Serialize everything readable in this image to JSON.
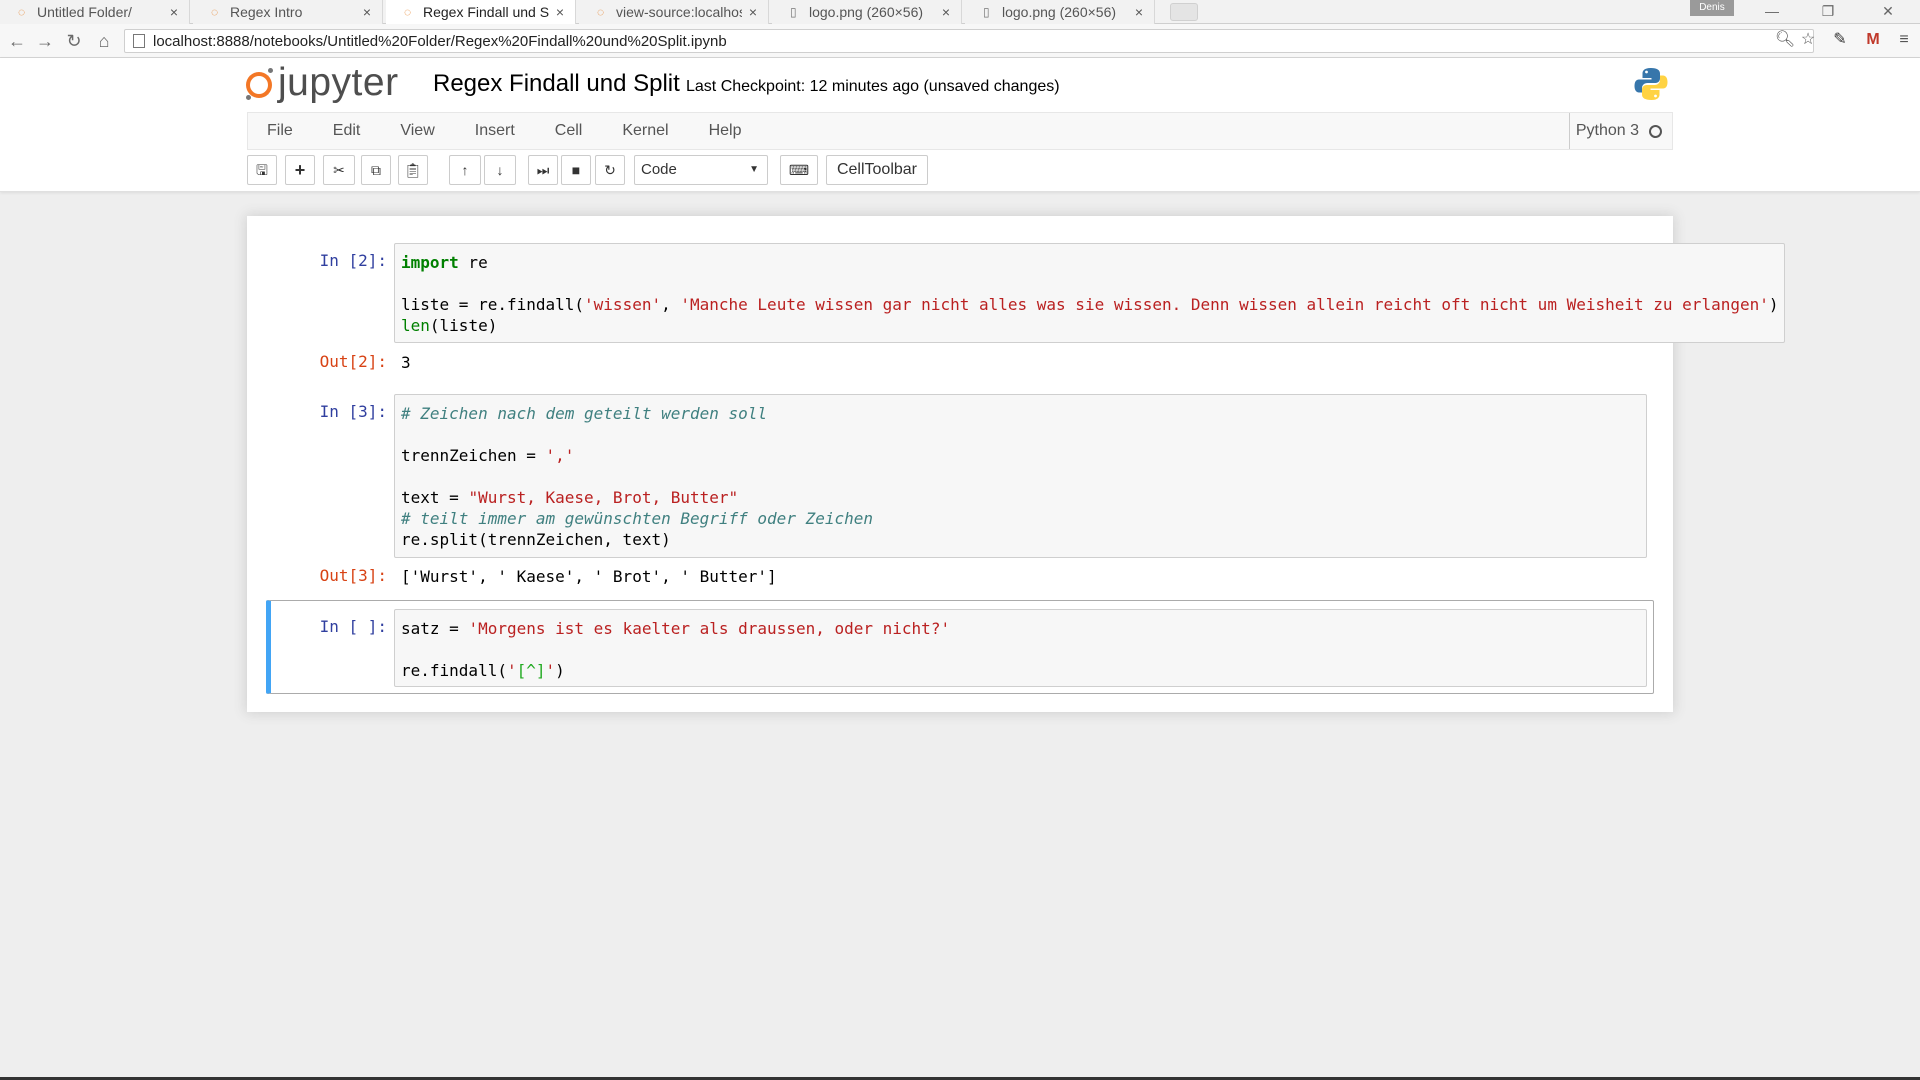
{
  "browser": {
    "tabs": [
      {
        "title": "Untitled Folder/",
        "icon": "jupyter-tab-icon",
        "active": false
      },
      {
        "title": "Regex Intro",
        "icon": "jupyter-tab-icon",
        "active": false
      },
      {
        "title": "Regex Findall und Sp",
        "icon": "jupyter-tab-icon",
        "active": true
      },
      {
        "title": "view-source:localhos",
        "icon": "jupyter-tab-icon",
        "active": false
      },
      {
        "title": "logo.png (260×56)",
        "icon": "file-tab-icon",
        "active": false
      },
      {
        "title": "logo.png (260×56)",
        "icon": "file-tab-icon",
        "active": false
      }
    ],
    "close_glyph": "×",
    "user_badge": "Denis",
    "url": "localhost:8888/notebooks/Untitled%20Folder/Regex%20Findall%20und%20Split.ipynb"
  },
  "jupyter": {
    "logo_text": "jupyter",
    "notebook_title": "Regex Findall und Split",
    "checkpoint": "Last Checkpoint: 12 minutes ago (unsaved changes)",
    "menu": [
      "File",
      "Edit",
      "View",
      "Insert",
      "Cell",
      "Kernel",
      "Help"
    ],
    "kernel_name": "Python 3",
    "cell_type_select": "Code",
    "celltoolbar_label": "CellToolbar",
    "colors": {
      "accent_blue": "#42A5F5",
      "prompt_in": "#303F9F",
      "prompt_out": "#D84315",
      "logo_orange": "#f37726"
    }
  },
  "cells": {
    "c1": {
      "prompt": "In [2]:",
      "line1_kw": "import",
      "line1_rest": " re",
      "line3_a": "liste = re.findall(",
      "line3_s1": "'wissen'",
      "line3_b": ", ",
      "line3_s2": "'Manche Leute wissen gar nicht alles was sie wissen. Denn wissen allein reicht oft nicht um Weisheit zu erlangen'",
      "line3_c": ")",
      "line4_bi": "len",
      "line4_rest": "(liste)",
      "out_prompt": "Out[2]:",
      "output": "3"
    },
    "c2": {
      "prompt": "In [3]:",
      "comment1": "# Zeichen nach dem geteilt werden soll",
      "line3_a": "trennZeichen = ",
      "line3_s": "','",
      "line5_a": "text = ",
      "line5_s": "\"Wurst, Kaese, Brot, Butter\"",
      "comment2": "# teilt immer am gewünschten Begriff oder Zeichen",
      "line7": "re.split(trennZeichen, text)",
      "out_prompt": "Out[3]:",
      "output": "['Wurst', ' Kaese', ' Brot', ' Butter']"
    },
    "c3": {
      "prompt": "In [ ]:",
      "line1_a": "satz = ",
      "line1_s": "'Morgens ist es kaelter als draussen, oder nicht?'",
      "line3_a": "re.findall(",
      "line3_q1": "'",
      "line3_rx": "[^]",
      "line3_q2": "'",
      "line3_c": ")"
    }
  }
}
